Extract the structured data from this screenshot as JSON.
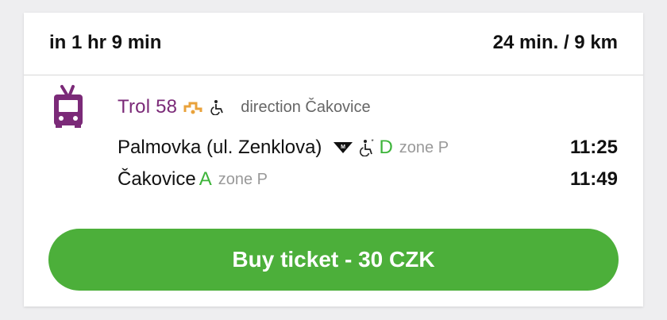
{
  "header": {
    "departure": "in 1 hr 9 min",
    "duration_distance": "24 min. / 9 km"
  },
  "route": {
    "vehicle_icon": "trolleybus-icon",
    "line_name": "Trol 58",
    "line_color": "#7b2a78",
    "direction": "direction Čakovice",
    "stops": [
      {
        "name": "Palmovka (ul. Zenklova)",
        "icons": [
          "metro-icon",
          "wheelchair-icon"
        ],
        "platform": "D",
        "zone": "zone P",
        "time": "11:25"
      },
      {
        "name": "Čakovice",
        "platform": "A",
        "zone": "zone P",
        "time": "11:49"
      }
    ]
  },
  "buy_button": {
    "label": "Buy ticket - 30 CZK",
    "color": "#4caf3a"
  }
}
